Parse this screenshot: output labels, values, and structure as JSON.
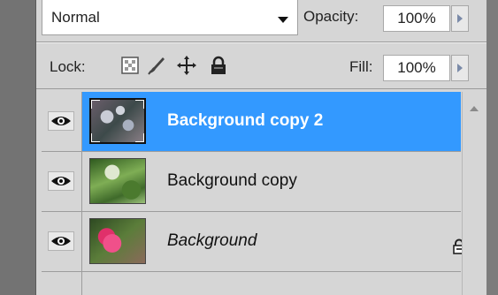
{
  "blend_mode": {
    "value": "Normal"
  },
  "opacity": {
    "label": "Opacity:",
    "value": "100%"
  },
  "lock": {
    "label": "Lock:",
    "icons": [
      "lock-transparent-pixels-icon",
      "lock-image-pixels-icon",
      "lock-position-icon",
      "lock-all-icon"
    ]
  },
  "fill": {
    "label": "Fill:",
    "value": "100%"
  },
  "layers": [
    {
      "name": "Background copy 2",
      "selected": true,
      "visible": true
    },
    {
      "name": "Background copy",
      "selected": false,
      "visible": true
    },
    {
      "name": "Background",
      "selected": false,
      "visible": true,
      "locked": true
    }
  ],
  "colors": {
    "selection": "#3399ff",
    "panel": "#d6d6d6"
  }
}
